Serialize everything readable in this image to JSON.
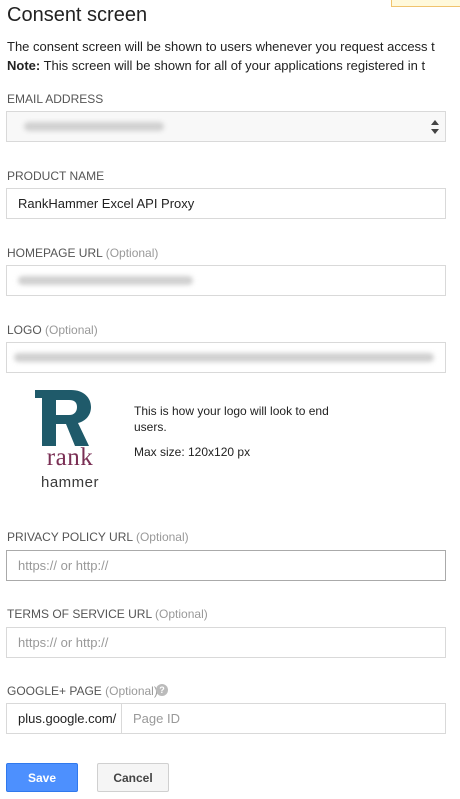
{
  "page": {
    "title": "Consent screen",
    "intro_line1": "The consent screen will be shown to users whenever you request access t",
    "intro_note_label": "Note:",
    "intro_note_text": " This screen will be shown for all of your applications registered in t"
  },
  "form": {
    "email": {
      "label": "EMAIL ADDRESS"
    },
    "product_name": {
      "label": "PRODUCT NAME",
      "value": "RankHammer Excel API Proxy"
    },
    "homepage_url": {
      "label": "HOMEPAGE URL",
      "optional": "(Optional)"
    },
    "logo": {
      "label": "LOGO",
      "optional": "(Optional)",
      "preview_word1": "rank",
      "preview_word2": "hammer",
      "preview_note": "This is how your logo will look to end users.",
      "max_size": "Max size: 120x120 px"
    },
    "privacy_policy_url": {
      "label": "PRIVACY POLICY URL",
      "optional": "(Optional)",
      "placeholder": "https:// or http://"
    },
    "terms_of_service_url": {
      "label": "TERMS OF SERVICE URL",
      "optional": "(Optional)",
      "placeholder": "https:// or http://"
    },
    "google_plus_page": {
      "label": "GOOGLE+ PAGE",
      "optional": "(Optional)",
      "prefix": "plus.google.com/",
      "placeholder": "Page ID",
      "help_glyph": "?"
    }
  },
  "actions": {
    "save": "Save",
    "cancel": "Cancel"
  },
  "colors": {
    "primary": "#4d90fe",
    "logo_teal": "#1f5a6a",
    "logo_purple": "#7a2f54"
  },
  "icons": {
    "select_arrows": "sort-arrows-icon",
    "help": "question-circle-icon"
  }
}
